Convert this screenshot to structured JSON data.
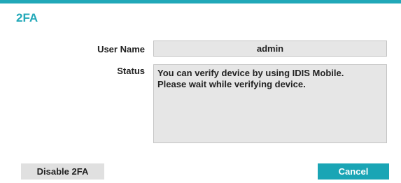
{
  "dialog": {
    "title": "2FA"
  },
  "form": {
    "user_name_label": "User Name",
    "user_name_value": "admin",
    "status_label": "Status",
    "status_lines": [
      "You can verify device by using IDIS Mobile.",
      "Please wait while verifying device."
    ]
  },
  "buttons": {
    "disable_label": "Disable 2FA",
    "cancel_label": "Cancel"
  },
  "colors": {
    "accent": "#21a8b8",
    "field_background": "#e6e6e6",
    "secondary_button": "#e0e0e0"
  }
}
